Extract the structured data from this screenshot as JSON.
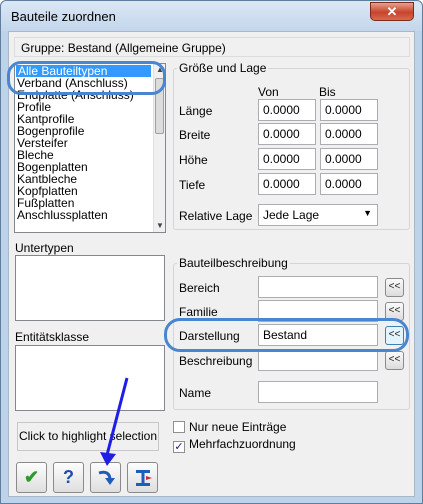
{
  "window": {
    "title": "Bauteile zuordnen",
    "close_label": "✕"
  },
  "group": {
    "label": "Gruppe: Bestand (Allgemeine Gruppe)"
  },
  "types_list": {
    "items": [
      "Alle Bauteiltypen",
      "Verband (Anschluss)",
      "Endplatte (Anschluss)",
      "Profile",
      "Kantprofile",
      "Bogenprofile",
      "Versteifer",
      "Bleche",
      "Bogenplatten",
      "Kantbleche",
      "Kopfplatten",
      "Fußplatten",
      "Anschlussplatten"
    ],
    "selected_index": 0
  },
  "size_position": {
    "legend": "Größe und Lage",
    "col_from": "Von",
    "col_to": "Bis",
    "rows": [
      {
        "label": "Länge",
        "from": "0.0000",
        "to": "0.0000"
      },
      {
        "label": "Breite",
        "from": "0.0000",
        "to": "0.0000"
      },
      {
        "label": "Höhe",
        "from": "0.0000",
        "to": "0.0000"
      },
      {
        "label": "Tiefe",
        "from": "0.0000",
        "to": "0.0000"
      }
    ],
    "relative_label": "Relative Lage",
    "relative_value": "Jede Lage"
  },
  "subtypes": {
    "label": "Untertypen"
  },
  "entity_class": {
    "label": "Entitätsklasse"
  },
  "description": {
    "legend": "Bauteilbeschreibung",
    "rows": [
      {
        "label": "Bereich",
        "value": "",
        "button": "<<"
      },
      {
        "label": "Familie",
        "value": "",
        "button": "<<"
      },
      {
        "label": "Darstellung",
        "value": "Bestand",
        "button": "<<"
      },
      {
        "label": "Beschreibung",
        "value": "",
        "button": "<<"
      },
      {
        "label": "Name",
        "value": ""
      }
    ]
  },
  "options": {
    "new_entries": {
      "label": "Nur neue Einträge",
      "checked": false
    },
    "multi_assign": {
      "label": "Mehrfachzuordnung",
      "checked": true
    }
  },
  "highlight_button": {
    "label": "Click to highlight selection"
  },
  "toolbar": {
    "ok_icon": "checkmark-icon",
    "help_label": "?",
    "apply_icon": "curved-arrow-icon",
    "select_icon": "beam-select-icon"
  },
  "annotation": {
    "color": "#4a86d0",
    "arrow_color": "#1e1ee6"
  }
}
